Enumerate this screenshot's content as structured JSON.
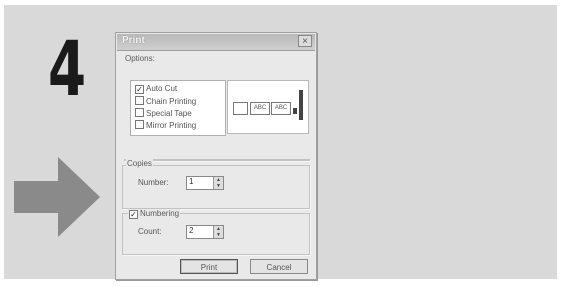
{
  "step": {
    "number": "4"
  },
  "dialog": {
    "title": "Print",
    "close_glyph": "×",
    "options": {
      "label": "Options:",
      "items": [
        {
          "label": "Auto Cut",
          "checked": true
        },
        {
          "label": "Chain Printing",
          "checked": false
        },
        {
          "label": "Special Tape",
          "checked": false
        },
        {
          "label": "Mirror Printing",
          "checked": false
        }
      ],
      "preview_tapes": [
        "ABC",
        "ABC"
      ]
    },
    "copies": {
      "label": "Copies",
      "number_label": "Number:",
      "number_value": "1"
    },
    "numbering": {
      "label": "Numbering",
      "checked": true,
      "count_label": "Count:",
      "count_value": "2"
    },
    "buttons": {
      "print": "Print",
      "cancel": "Cancel"
    }
  },
  "colors": {
    "panel_bg": "#d9d9d9",
    "arrow": "#8a8a8a",
    "step_number": "#1a1a1a"
  }
}
